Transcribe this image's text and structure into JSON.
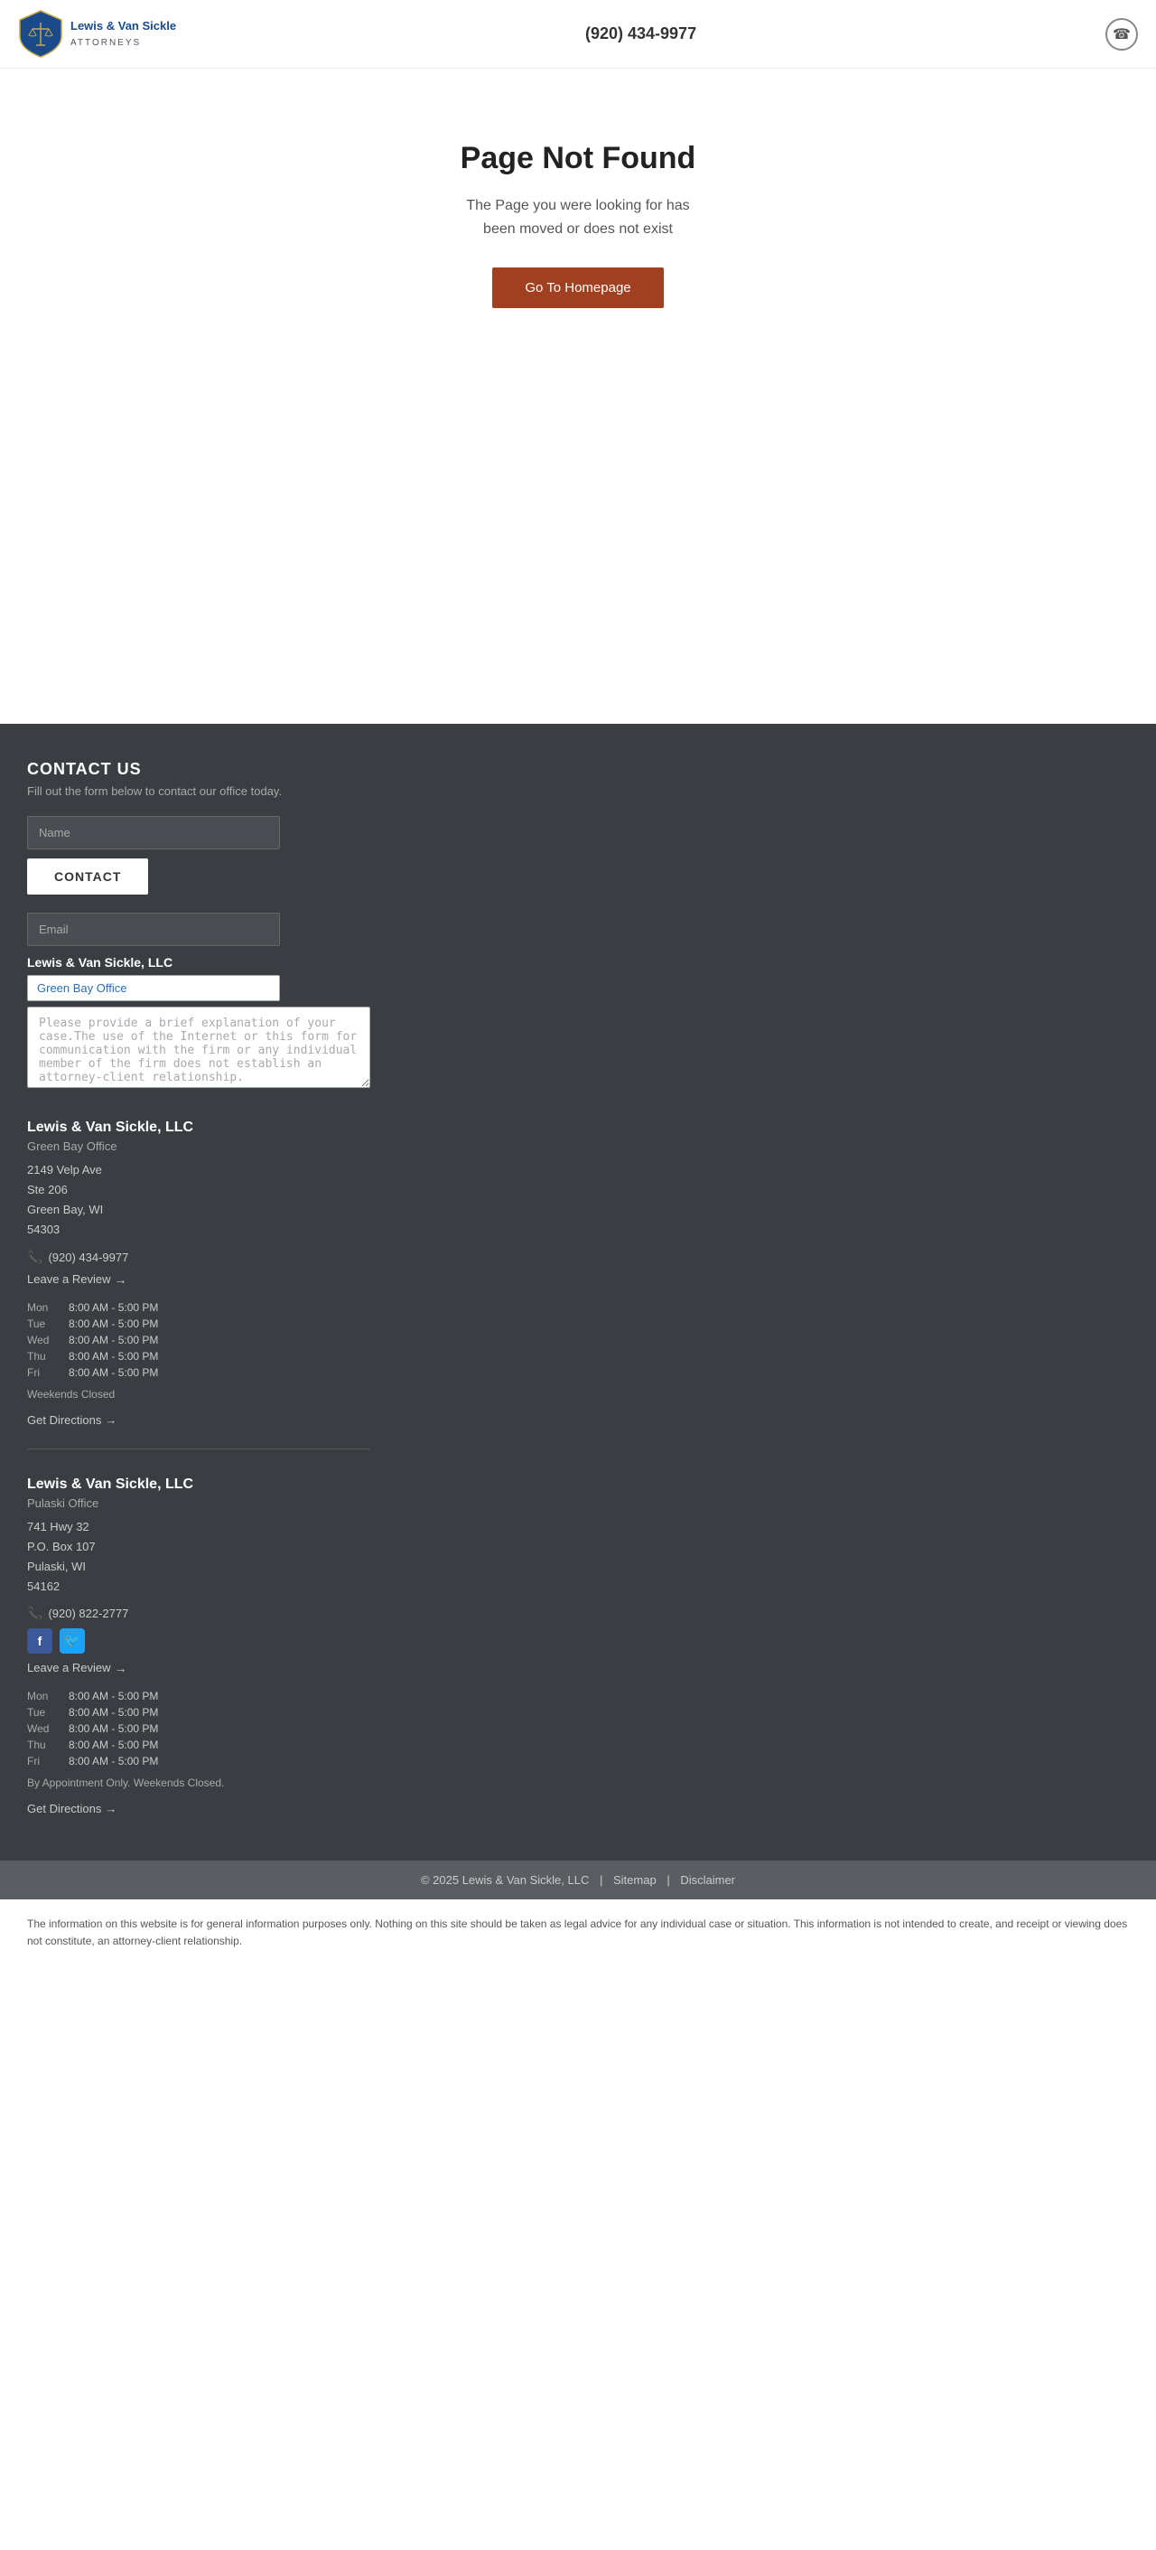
{
  "header": {
    "logo_alt": "Lewis & Van Sickle Attorneys",
    "phone": "(920) 434-9977",
    "phone_icon": "☎"
  },
  "not_found": {
    "title": "Page Not Found",
    "message_line1": "The Page you were looking for has",
    "message_line2": "been moved or does not exist",
    "button_label": "Go To Homepage"
  },
  "footer": {
    "contact_heading": "CONTACT US",
    "contact_subtitle": "Fill out the form below to contact our office today.",
    "name_placeholder": "Name",
    "contact_button": "CONTACT",
    "email_placeholder": "Email",
    "company_name": "Lewis & Van Sickle, LLC",
    "dropdown_label": "Green Bay Office",
    "message_placeholder": "Please provide a brief explanation of your case.The use of the Internet or this form for communication with the firm or any individual member of the firm does not establish an attorney-client relationship.",
    "offices": [
      {
        "name": "Lewis & Van Sickle, LLC",
        "label": "Green Bay Office",
        "address_lines": [
          "2149 Velp Ave",
          "Ste 206",
          "Green Bay, WI",
          "54303"
        ],
        "phone": "(920) 434-9977",
        "leave_review": "Leave a Review",
        "hours": [
          {
            "day": "Mon",
            "time": "8:00 AM - 5:00 PM"
          },
          {
            "day": "Tue",
            "time": "8:00 AM - 5:00 PM"
          },
          {
            "day": "Wed",
            "time": "8:00 AM - 5:00 PM"
          },
          {
            "day": "Thu",
            "time": "8:00 AM - 5:00 PM"
          },
          {
            "day": "Fri",
            "time": "8:00 AM - 5:00 PM"
          }
        ],
        "closed_note": "Weekends Closed",
        "directions_label": "Get Directions",
        "has_social": false
      },
      {
        "name": "Lewis & Van Sickle, LLC",
        "label": "Pulaski Office",
        "address_lines": [
          "741 Hwy 32",
          "P.O. Box 107",
          "Pulaski, WI",
          "54162"
        ],
        "phone": "(920) 822-2777",
        "leave_review": "Leave a Review",
        "hours": [
          {
            "day": "Mon",
            "time": "8:00 AM - 5:00 PM"
          },
          {
            "day": "Tue",
            "time": "8:00 AM - 5:00 PM"
          },
          {
            "day": "Wed",
            "time": "8:00 AM - 5:00 PM"
          },
          {
            "day": "Thu",
            "time": "8:00 AM - 5:00 PM"
          },
          {
            "day": "Fri",
            "time": "8:00 AM - 5:00 PM"
          }
        ],
        "closed_note": "By Appointment Only. Weekends Closed.",
        "directions_label": "Get Directions",
        "has_social": true
      }
    ],
    "copyright": "© 2025 Lewis & Van Sickle, LLC",
    "sitemap": "Sitemap",
    "disclaimer_link": "Disclaimer",
    "disclaimer_text": "The information on this website is for general information purposes only. Nothing on this site should be taken as legal advice for any individual case or situation. This information is not intended to create, and receipt or viewing does not constitute, an attorney-client relationship."
  }
}
